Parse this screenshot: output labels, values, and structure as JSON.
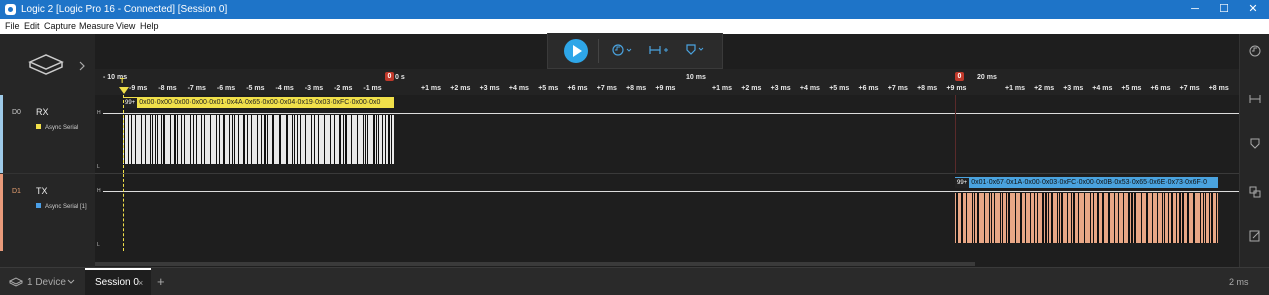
{
  "window": {
    "title": "Logic 2 [Logic Pro 16 - Connected] [Session 0]",
    "minimize": "─",
    "maximize": "☐",
    "close": "✕"
  },
  "menu": [
    "File",
    "Edit",
    "Capture",
    "Measure",
    "View",
    "Help"
  ],
  "ruler": {
    "big": [
      "- 10 ms",
      "0 s",
      "10 ms",
      "20 ms"
    ],
    "small_left": [
      "-9 ms",
      "-8 ms",
      "-7 ms",
      "-6 ms",
      "-5 ms",
      "-4 ms",
      "-3 ms",
      "-2 ms",
      "-1 ms"
    ],
    "small_mid": [
      "+1 ms",
      "+2 ms",
      "+3 ms",
      "+4 ms",
      "+5 ms",
      "+6 ms",
      "+7 ms",
      "+8 ms",
      "+9 ms"
    ],
    "small_right": [
      "+1 ms",
      "+2 ms",
      "+3 ms",
      "+4 ms",
      "+5 ms",
      "+6 ms",
      "+7 ms",
      "+8 ms",
      "+9 ms"
    ],
    "small_far": [
      "+1 ms",
      "+2 ms",
      "+3 ms",
      "+4 ms",
      "+5 ms",
      "+6 ms",
      "+7 ms",
      "+8 ms"
    ],
    "marker0": "0",
    "marker1": "0",
    "cursor": "T"
  },
  "channels": [
    {
      "num": "D0",
      "name": "RX",
      "analyzer": "Async Serial",
      "color": "#f1e04a",
      "stripe": "#9ecae8",
      "badge": "99+",
      "decode": "0x00·0x00·0x00·0x00·0x01·0x4A·0x65·0x00·0x04·0x19·0x03·0xFC·0x00·0x0",
      "decode_bg": "#f1e04a",
      "high": "H",
      "low": "L"
    },
    {
      "num": "D1",
      "name": "TX",
      "analyzer": "Async Serial [1]",
      "color": "#4a9fe8",
      "stripe": "#e89a7a",
      "badge": "99+",
      "decode": "0x01·0x67·0x1A·0x00·0x03·0xFC·0x00·0x0B·0x53·0x65·0x6E·0x73·0x6F·0",
      "decode_bg": "#4aa3df",
      "high": "H",
      "low": "L"
    }
  ],
  "toolbar": {
    "trigger_icon": "trigger-icon",
    "measure_icon": "measure-icon",
    "marker_icon": "marker-icon"
  },
  "bottom": {
    "device": "1 Device",
    "session_tab": "Session 0",
    "session_close": "×",
    "add_tab": "+",
    "zoom": "2 ms"
  },
  "colors": {
    "accent": "#2ea6e8",
    "rx_fill": "#e9e9e9",
    "tx_fill": "#e8a786"
  },
  "right_icons": [
    "trigger-panel-icon",
    "measure-panel-icon",
    "marker-panel-icon",
    "analyzer-panel-icon",
    "notes-panel-icon"
  ]
}
